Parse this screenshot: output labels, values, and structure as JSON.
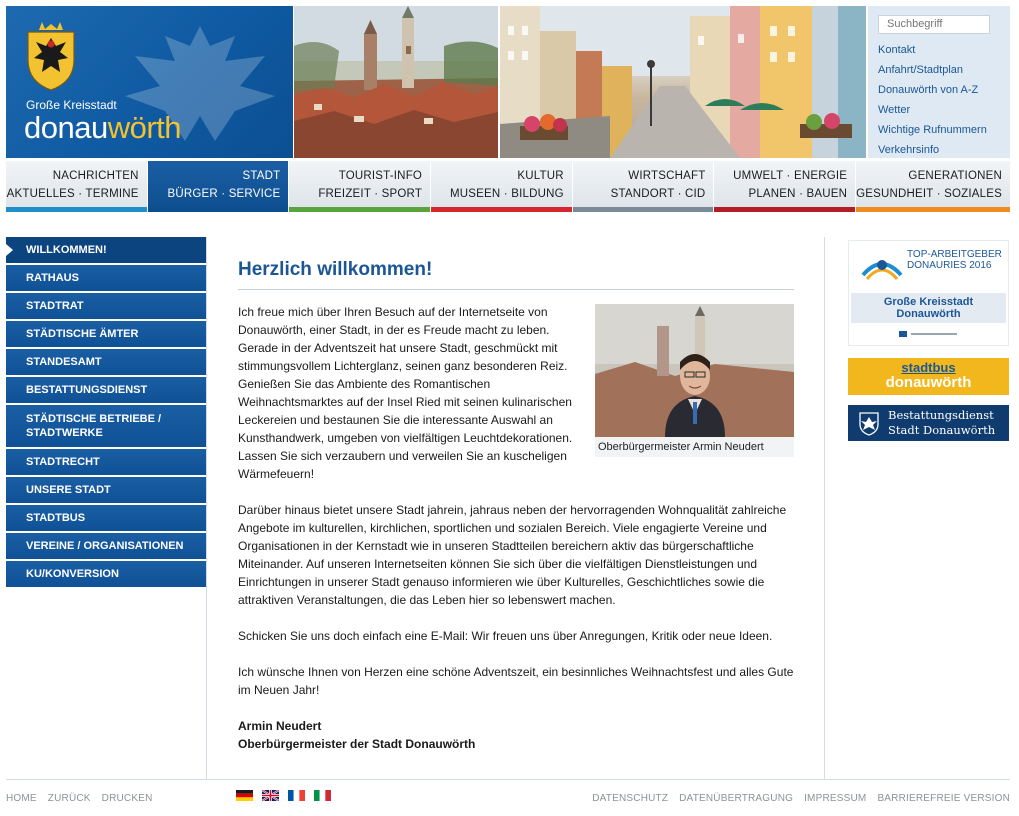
{
  "header": {
    "city_subtitle": "Große Kreisstadt",
    "city_name_part1": "donau",
    "city_name_part2": "wörth",
    "search_placeholder": "Suchbegriff",
    "quicklinks": [
      "Kontakt",
      "Anfahrt/Stadtplan",
      "Donauwörth von A-Z",
      "Wetter",
      "Wichtige Rufnummern",
      "Verkehrsinfo"
    ]
  },
  "mainnav": [
    {
      "line1": "NACHRICHTEN",
      "line2": "AKTUELLES · TERMINE",
      "bar_color": "#1e8fc9",
      "active": false
    },
    {
      "line1": "STADT",
      "line2": "BÜRGER · SERVICE",
      "bar_color": "#0d4e8f",
      "active": true
    },
    {
      "line1": "TOURIST-INFO",
      "line2": "FREIZEIT · SPORT",
      "bar_color": "#5aa53b",
      "active": false
    },
    {
      "line1": "KULTUR",
      "line2": "MUSEEN · BILDUNG",
      "bar_color": "#d6262e",
      "active": false
    },
    {
      "line1": "WIRTSCHAFT",
      "line2": "STANDORT · CID",
      "bar_color": "#7b8a97",
      "active": false
    },
    {
      "line1": "UMWELT · ENERGIE",
      "line2": "PLANEN · BAUEN",
      "bar_color": "#b31e22",
      "active": false
    },
    {
      "line1": "GENERATIONEN",
      "line2": "GESUNDHEIT · SOZIALES",
      "bar_color": "#f08b1d",
      "active": false
    }
  ],
  "sidebar": [
    "WILLKOMMEN!",
    "RATHAUS",
    "STADTRAT",
    "STÄDTISCHE ÄMTER",
    "STANDESAMT",
    "BESTATTUNGSDIENST",
    "STÄDTISCHE BETRIEBE / STADTWERKE",
    "STADTRECHT",
    "UNSERE STADT",
    "STADTBUS",
    "VEREINE / ORGANISATIONEN",
    "KU/KONVERSION"
  ],
  "content": {
    "title": "Herzlich willkommen!",
    "p1": "Ich freue mich über Ihren Besuch auf der Internetseite von Donauwörth, einer Stadt, in der es Freude macht zu leben. Gerade in der Adventszeit hat unsere Stadt, geschmückt mit stimmungsvollem Lichterglanz, seinen ganz besonderen Reiz. Genießen Sie das Ambiente des Romantischen Weihnachtsmarktes auf der Insel Ried mit seinen kulinarischen Leckereien und bestaunen Sie die interessante Auswahl an Kunsthandwerk, umgeben von vielfältigen Leuchtdekorationen. Lassen Sie sich verzaubern und verweilen Sie an kuscheligen Wärmefeuern!",
    "p2": "Darüber hinaus bietet unsere Stadt jahrein, jahraus neben der hervorragenden Wohnqualität zahlreiche Angebote im kulturellen, kirchlichen, sportlichen und sozialen Bereich. Viele engagierte Vereine und Organisationen in der Kernstadt wie in unseren Stadtteilen bereichern aktiv das bürgerschaftliche Miteinander. Auf unseren Internetseiten können Sie sich über die vielfältigen Dienstleistungen und Einrichtungen in unserer Stadt genauso informieren wie über Kulturelles, Geschichtliches sowie die attraktiven Veranstaltungen, die das Leben hier so lebenswert machen.",
    "p3": "Schicken Sie uns doch einfach eine E-Mail: Wir freuen uns über Anregungen, Kritik oder neue Ideen.",
    "p4": "Ich wünsche Ihnen von Herzen eine schöne Adventszeit, ein besinnliches Weihnachtsfest und alles Gute im Neuen Jahr!",
    "sig_name": "Armin Neudert",
    "sig_title": "Oberbürgermeister der Stadt Donauwörth",
    "photo_caption": "Oberbürgermeister Armin Neudert"
  },
  "banners": {
    "b1_line1": "TOP-ARBEITGEBER",
    "b1_line2": "DONAURIES 2016",
    "b1_mid1": "Große Kreisstadt",
    "b1_mid2": "Donauwörth",
    "b2_line1": "stadtbus",
    "b2_line2": "donauwörth",
    "b3_line1": "Bestattungsdienst",
    "b3_line2": "Stadt Donauwörth"
  },
  "footer": {
    "left": [
      "HOME",
      "ZURÜCK",
      "DRUCKEN"
    ],
    "right": [
      "DATENSCHUTZ",
      "DATENÜBERTRAGUNG",
      "IMPRESSUM",
      "BARRIEREFREIE VERSION"
    ],
    "flags": [
      "de-flag-icon",
      "uk-flag-icon",
      "fr-flag-icon",
      "it-flag-icon"
    ]
  }
}
